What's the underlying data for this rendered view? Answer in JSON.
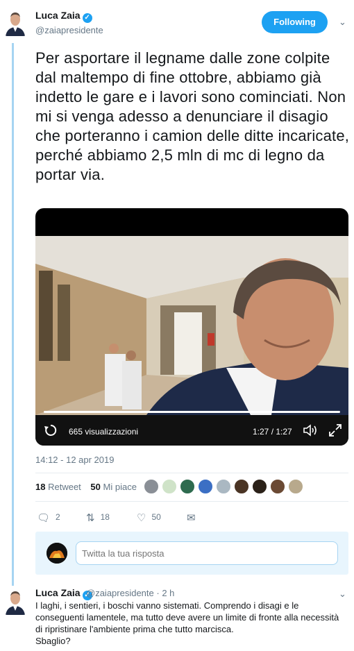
{
  "colors": {
    "accent": "#1da1f2",
    "thread_line": "#a6d4f2",
    "secondary_text": "#657786"
  },
  "main_tweet": {
    "author_name": "Luca Zaia",
    "author_handle": "@zaiapresidente",
    "follow_label": "Following",
    "text": "Per asportare il legname dalle zone colpite dal maltempo di fine ottobre, abbiamo già indetto le gare e i lavori sono cominciati. Non mi si venga adesso a denunciare il disagio che porteranno i camion delle ditte incaricate, perché abbiamo 2,5 mln di mc di legno da portar via.",
    "video": {
      "views": "665 visualizzazioni",
      "time": "1:27 / 1:27",
      "progress": 1.0
    },
    "timestamp": "14:12 - 12 apr 2019",
    "stats": {
      "retweets_count": "18",
      "retweets_label": "Retweet",
      "likes_count": "50",
      "likes_label": "Mi piace"
    },
    "actions": {
      "replies": "2",
      "retweets": "18",
      "likes": "50"
    }
  },
  "reply_box": {
    "placeholder": "Twitta la tua risposta"
  },
  "reply_tweet": {
    "author_name": "Luca Zaia",
    "author_handle": "@zaiapresidente",
    "time": "2 h",
    "text_line1": "I laghi, i sentieri, i boschi vanno sistemati. Comprendo i disagi e le conseguenti lamentele, ma tutto deve avere un limite di fronte alla necessità di ripristinare l'ambiente prima che tutto marcisca.",
    "text_line2": "Sbaglio?"
  }
}
